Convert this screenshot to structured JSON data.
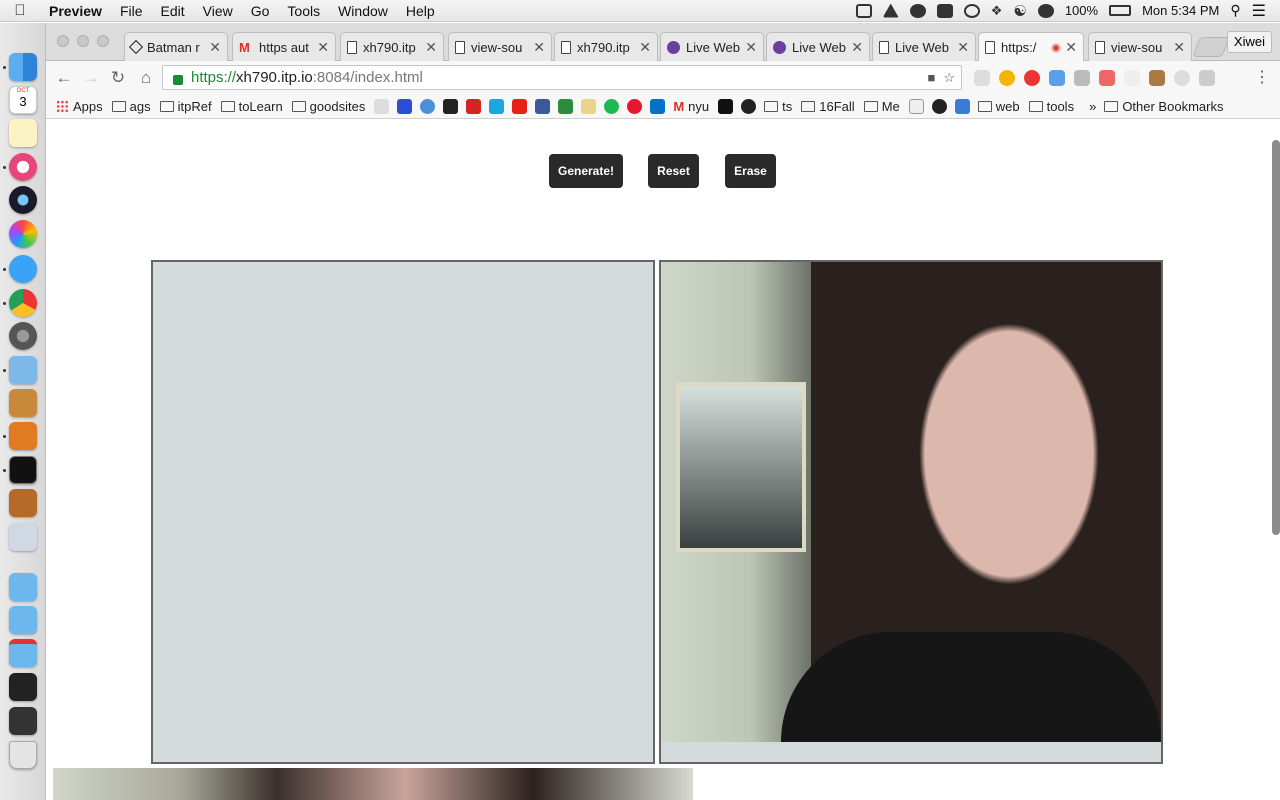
{
  "menubar": {
    "app_name": "Preview",
    "items": [
      "File",
      "Edit",
      "View",
      "Go",
      "Tools",
      "Window",
      "Help"
    ],
    "battery": "100%",
    "clock": "Mon 5:34 PM"
  },
  "dock": {
    "calendar_month": "OCT",
    "calendar_day": "3"
  },
  "browser": {
    "tabs": [
      {
        "title": "Batman r",
        "icon": "codepen-icon"
      },
      {
        "title": "https aut",
        "icon": "gmail-icon"
      },
      {
        "title": "xh790.itp",
        "icon": "document-icon"
      },
      {
        "title": "view-sou",
        "icon": "document-icon"
      },
      {
        "title": "xh790.itp",
        "icon": "document-icon"
      },
      {
        "title": "Live Web",
        "icon": "itp-icon"
      },
      {
        "title": "Live Web",
        "icon": "itp-icon"
      },
      {
        "title": "Live Web",
        "icon": "document-icon"
      },
      {
        "title": "https:/",
        "icon": "document-icon",
        "active": true,
        "recording": true
      },
      {
        "title": "view-sou",
        "icon": "document-icon"
      }
    ],
    "profile_name": "Xiwei",
    "url": {
      "scheme": "https://",
      "host": "xh790.itp.io",
      "path": ":8084/index.html"
    },
    "bookmarks": {
      "apps": "Apps",
      "folders_left": [
        "ags",
        "itpRef",
        "toLearn",
        "goodsites"
      ],
      "nyu": "nyu",
      "folders_mid": [
        "ts",
        "16Fall",
        "Me"
      ],
      "folders_right": [
        "web",
        "tools"
      ],
      "other": "Other Bookmarks"
    }
  },
  "page": {
    "generate_label": "Generate!",
    "reset_label": "Reset",
    "erase_label": "Erase"
  }
}
